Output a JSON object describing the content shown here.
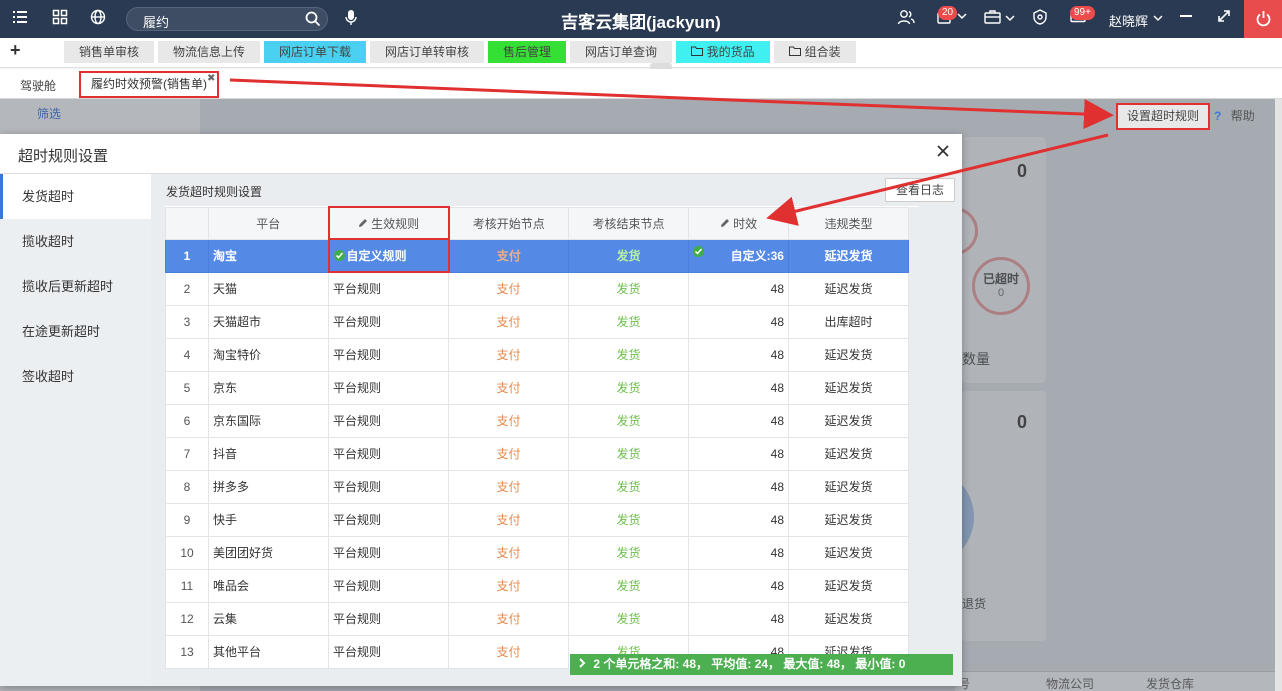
{
  "topbar": {
    "search_value": "履约",
    "title": "吉客云集团(jackyun)",
    "notif_badge": "20",
    "mail_badge": "99+",
    "username": "赵晓辉"
  },
  "quicknav": {
    "items": [
      {
        "label": "销售单审核"
      },
      {
        "label": "物流信息上传"
      },
      {
        "label": "网店订单下载"
      },
      {
        "label": "网店订单转审核"
      },
      {
        "label": "售后管理"
      },
      {
        "label": "网店订单查询"
      },
      {
        "label": "我的货品"
      },
      {
        "label": "组合装"
      }
    ]
  },
  "tabs": {
    "items": [
      {
        "label": "驾驶舱"
      },
      {
        "label": "履约时效预警(销售单)"
      }
    ]
  },
  "background": {
    "filter_label": "筛选",
    "set_rule_button": "设置超时规则",
    "help_label": "帮助",
    "zero1": "0",
    "zero2": "0",
    "overdue_label": "已超时",
    "overdue_value": "0",
    "quantity_label": "数量",
    "return_label": "退货",
    "footer_col1": "号",
    "footer_col2": "物流公司",
    "footer_col3": "发货仓库"
  },
  "modal": {
    "title": "超时规则设置",
    "side_items": [
      "发货超时",
      "揽收超时",
      "揽收后更新超时",
      "在途更新超时",
      "签收超时"
    ],
    "content_title": "发货超时规则设置",
    "log_button": "查看日志",
    "columns": [
      "平台",
      "生效规则",
      "考核开始节点",
      "考核结束节点",
      "时效",
      "违规类型"
    ],
    "rows": [
      {
        "no": "1",
        "platform": "淘宝",
        "rule": "自定义规则",
        "start": "支付",
        "end": "发货",
        "time": "自定义:36",
        "type": "延迟发货"
      },
      {
        "no": "2",
        "platform": "天猫",
        "rule": "平台规则",
        "start": "支付",
        "end": "发货",
        "time": "48",
        "type": "延迟发货"
      },
      {
        "no": "3",
        "platform": "天猫超市",
        "rule": "平台规则",
        "start": "支付",
        "end": "发货",
        "time": "48",
        "type": "出库超时"
      },
      {
        "no": "4",
        "platform": "淘宝特价",
        "rule": "平台规则",
        "start": "支付",
        "end": "发货",
        "time": "48",
        "type": "延迟发货"
      },
      {
        "no": "5",
        "platform": "京东",
        "rule": "平台规则",
        "start": "支付",
        "end": "发货",
        "time": "48",
        "type": "延迟发货"
      },
      {
        "no": "6",
        "platform": "京东国际",
        "rule": "平台规则",
        "start": "支付",
        "end": "发货",
        "time": "48",
        "type": "延迟发货"
      },
      {
        "no": "7",
        "platform": "抖音",
        "rule": "平台规则",
        "start": "支付",
        "end": "发货",
        "time": "48",
        "type": "延迟发货"
      },
      {
        "no": "8",
        "platform": "拼多多",
        "rule": "平台规则",
        "start": "支付",
        "end": "发货",
        "time": "48",
        "type": "延迟发货"
      },
      {
        "no": "9",
        "platform": "快手",
        "rule": "平台规则",
        "start": "支付",
        "end": "发货",
        "time": "48",
        "type": "延迟发货"
      },
      {
        "no": "10",
        "platform": "美团团好货",
        "rule": "平台规则",
        "start": "支付",
        "end": "发货",
        "time": "48",
        "type": "延迟发货"
      },
      {
        "no": "11",
        "platform": "唯品会",
        "rule": "平台规则",
        "start": "支付",
        "end": "发货",
        "time": "48",
        "type": "延迟发货"
      },
      {
        "no": "12",
        "platform": "云集",
        "rule": "平台规则",
        "start": "支付",
        "end": "发货",
        "time": "48",
        "type": "延迟发货"
      },
      {
        "no": "13",
        "platform": "其他平台",
        "rule": "平台规则",
        "start": "支付",
        "end": "发货",
        "time": "48",
        "type": "延迟发货"
      }
    ],
    "status_text": "2 个单元格之和: 48， 平均值: 24， 最大值: 48， 最小值: 0"
  },
  "colors": {
    "topbar": "#2a3a52",
    "selected_row": "#5489e6",
    "pay_text": "#e8884a",
    "ship_text": "#6cc04a",
    "annotation": "#e03030",
    "status_bar": "#4caf50"
  }
}
